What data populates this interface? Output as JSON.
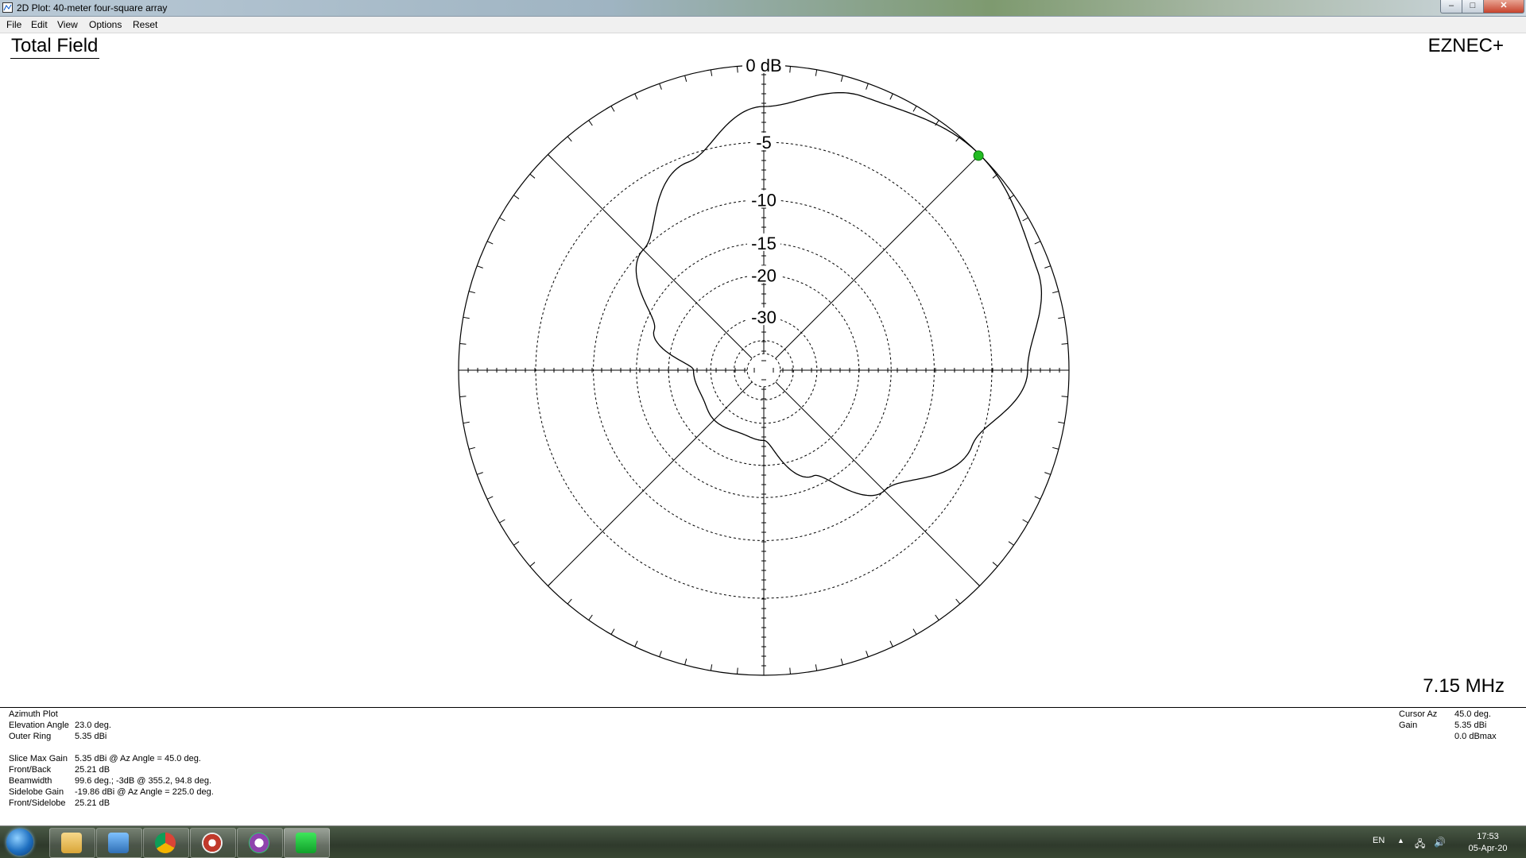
{
  "window": {
    "title": "2D Plot: 40-meter four-square array",
    "min_glyph": "–",
    "max_glyph": "□",
    "close_glyph": "✕"
  },
  "menu": [
    "File",
    "Edit",
    "View",
    "Options",
    "Reset"
  ],
  "plot": {
    "title": "Total Field",
    "brand": "EZNEC+",
    "frequency": "7.15 MHz",
    "ring_labels": [
      "0 dB",
      "-5",
      "-10",
      "-15",
      "-20",
      "-30"
    ]
  },
  "info_left": [
    {
      "label": "Azimuth Plot",
      "value": ""
    },
    {
      "label": "Elevation Angle",
      "value": "23.0 deg."
    },
    {
      "label": "Outer Ring",
      "value": "5.35 dBi"
    },
    {
      "label": "",
      "value": ""
    },
    {
      "label": "Slice Max Gain",
      "value": "5.35 dBi @ Az Angle = 45.0 deg."
    },
    {
      "label": "Front/Back",
      "value": "25.21 dB"
    },
    {
      "label": "Beamwidth",
      "value": "99.6 deg.; -3dB @ 355.2, 94.8 deg."
    },
    {
      "label": "Sidelobe Gain",
      "value": "-19.86 dBi @ Az Angle = 225.0 deg."
    },
    {
      "label": "Front/Sidelobe",
      "value": "25.21 dB"
    }
  ],
  "info_right": [
    {
      "label": "Cursor Az",
      "value": "45.0 deg."
    },
    {
      "label": "Gain",
      "value": "5.35 dBi"
    },
    {
      "label": "",
      "value": "0.0 dBmax"
    }
  ],
  "chart_data": {
    "type": "polar",
    "ring_db": [
      0,
      -5,
      -10,
      -15,
      -20,
      -30
    ],
    "ring_labels": [
      "0 dB",
      "-5",
      "-10",
      "-15",
      "-20",
      "-30"
    ],
    "cursor_azimuth_deg": 45.0,
    "cursor_rel_db": 0.0,
    "max_gain_dbi": 5.35,
    "pattern": {
      "azimuth_deg": [
        0,
        20,
        45,
        70,
        90,
        110,
        135,
        155,
        180,
        200,
        225,
        245,
        270,
        290,
        315,
        340
      ],
      "rel_db": [
        -2.5,
        -0.8,
        0.0,
        -0.8,
        -2.5,
        -5.5,
        -10.0,
        -16.5,
        -25.2,
        -26.0,
        -25.2,
        -26.0,
        -25.2,
        -16.5,
        -10.0,
        -5.5
      ]
    },
    "colors": {
      "pattern": "#000000",
      "cursor": "#22bb22",
      "grid": "#000000"
    }
  },
  "taskbar": {
    "language": "EN",
    "time": "17:53",
    "date": "05-Apr-20",
    "apps": [
      "explorer-icon",
      "remote-desktop-icon",
      "chrome-icon",
      "globe-app-icon",
      "ham-radio-app-icon",
      "eznec-icon"
    ],
    "tray_up": "▲",
    "tray_net": "🖧",
    "tray_vol": "🔊"
  }
}
